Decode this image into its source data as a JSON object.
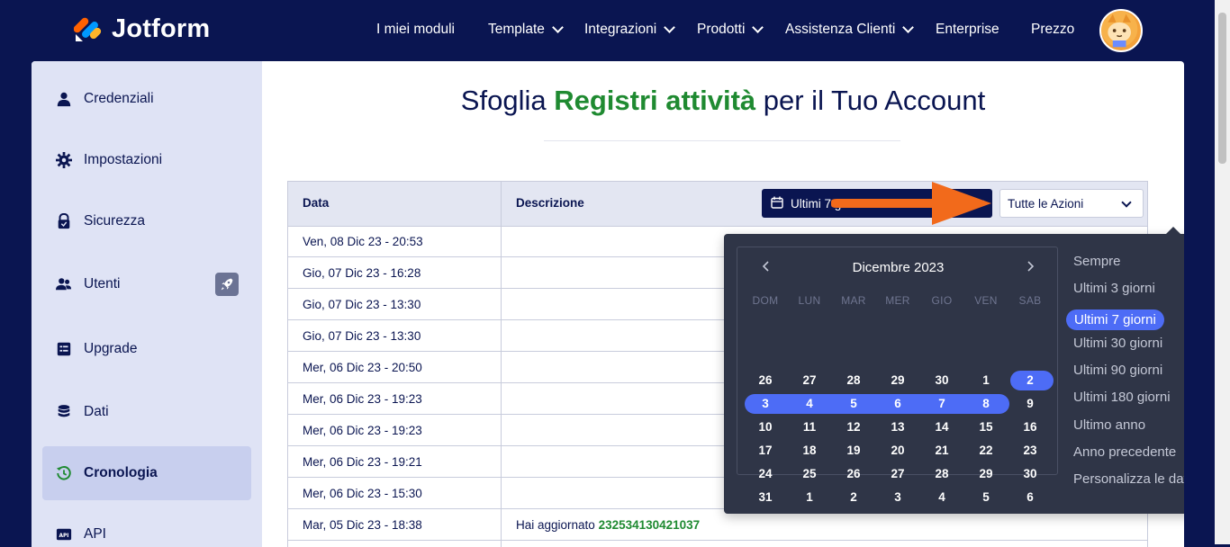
{
  "brand": {
    "name": "Jotform"
  },
  "nav": {
    "items": [
      {
        "label": "I miei moduli",
        "dropdown": false
      },
      {
        "label": "Template",
        "dropdown": true
      },
      {
        "label": "Integrazioni",
        "dropdown": true
      },
      {
        "label": "Prodotti",
        "dropdown": true
      },
      {
        "label": "Assistenza Clienti",
        "dropdown": true
      },
      {
        "label": "Enterprise",
        "dropdown": false
      },
      {
        "label": "Prezzo",
        "dropdown": false
      }
    ]
  },
  "sidebar": {
    "items": [
      {
        "label": "Credenziali",
        "icon": "user-icon",
        "active": false
      },
      {
        "label": "Impostazioni",
        "icon": "gear-icon",
        "active": false
      },
      {
        "label": "Sicurezza",
        "icon": "lock-icon",
        "active": false
      },
      {
        "label": "Utenti",
        "icon": "users-icon",
        "active": false,
        "badge": "rocket-icon"
      },
      {
        "label": "Upgrade",
        "icon": "upgrade-icon",
        "active": false
      },
      {
        "label": "Dati",
        "icon": "database-icon",
        "active": false
      },
      {
        "label": "Cronologia",
        "icon": "history-icon",
        "active": true
      },
      {
        "label": "API",
        "icon": "api-icon",
        "active": false
      }
    ]
  },
  "page": {
    "title_pre": "Sfoglia ",
    "title_highlight": "Registri attività",
    "title_post": " per il Tuo Account"
  },
  "table": {
    "headers": {
      "date": "Data",
      "description": "Descrizione"
    },
    "rows": [
      {
        "date": "Ven, 08 Dic 23 - 20:53",
        "desc": "",
        "id": ""
      },
      {
        "date": "Gio, 07 Dic 23 - 16:28",
        "desc": "",
        "id": ""
      },
      {
        "date": "Gio, 07 Dic 23 - 13:30",
        "desc": "",
        "id": ""
      },
      {
        "date": "Gio, 07 Dic 23 - 13:30",
        "desc": "",
        "id": ""
      },
      {
        "date": "Mer, 06 Dic 23 - 20:50",
        "desc": "",
        "id": ""
      },
      {
        "date": "Mer, 06 Dic 23 - 19:23",
        "desc": "",
        "id": ""
      },
      {
        "date": "Mer, 06 Dic 23 - 19:23",
        "desc": "",
        "id": ""
      },
      {
        "date": "Mer, 06 Dic 23 - 19:21",
        "desc": "",
        "id": ""
      },
      {
        "date": "Mer, 06 Dic 23 - 15:30",
        "desc": "",
        "id": ""
      },
      {
        "date": "Mar, 05 Dic 23 - 18:38",
        "desc": "Hai aggiornato ",
        "id": "232534130421037"
      },
      {
        "date": "",
        "desc": "",
        "id": ""
      }
    ]
  },
  "filters": {
    "date_range": "Ultimi 7 giorni",
    "actions": "Tutte le Azioni"
  },
  "datepicker": {
    "month_label": "Dicembre 2023",
    "weekdays": [
      "DOM",
      "LUN",
      "MAR",
      "MER",
      "GIO",
      "VEN",
      "SAB"
    ],
    "weeks": [
      [
        "26",
        "27",
        "28",
        "29",
        "30",
        "1",
        "2"
      ],
      [
        "3",
        "4",
        "5",
        "6",
        "7",
        "8",
        "9"
      ],
      [
        "10",
        "11",
        "12",
        "13",
        "14",
        "15",
        "16"
      ],
      [
        "17",
        "18",
        "19",
        "20",
        "21",
        "22",
        "23"
      ],
      [
        "24",
        "25",
        "26",
        "27",
        "28",
        "29",
        "30"
      ],
      [
        "31",
        "1",
        "2",
        "3",
        "4",
        "5",
        "6"
      ]
    ],
    "presets": [
      "Sempre",
      "Ultimi 3 giorni",
      "Ultimi 7 giorni",
      "Ultimi 30 giorni",
      "Ultimi 90 giorni",
      "Ultimi 180 giorni",
      "Ultimo anno",
      "Anno precedente",
      "Personalizza le date"
    ],
    "active_preset": "Ultimi 7 giorni"
  },
  "colors": {
    "navy": "#0a1551",
    "green": "#1f8a31",
    "selection_blue": "#4d6cf6",
    "popup_bg": "#2f3547",
    "arrow_orange": "#f26a1b"
  }
}
